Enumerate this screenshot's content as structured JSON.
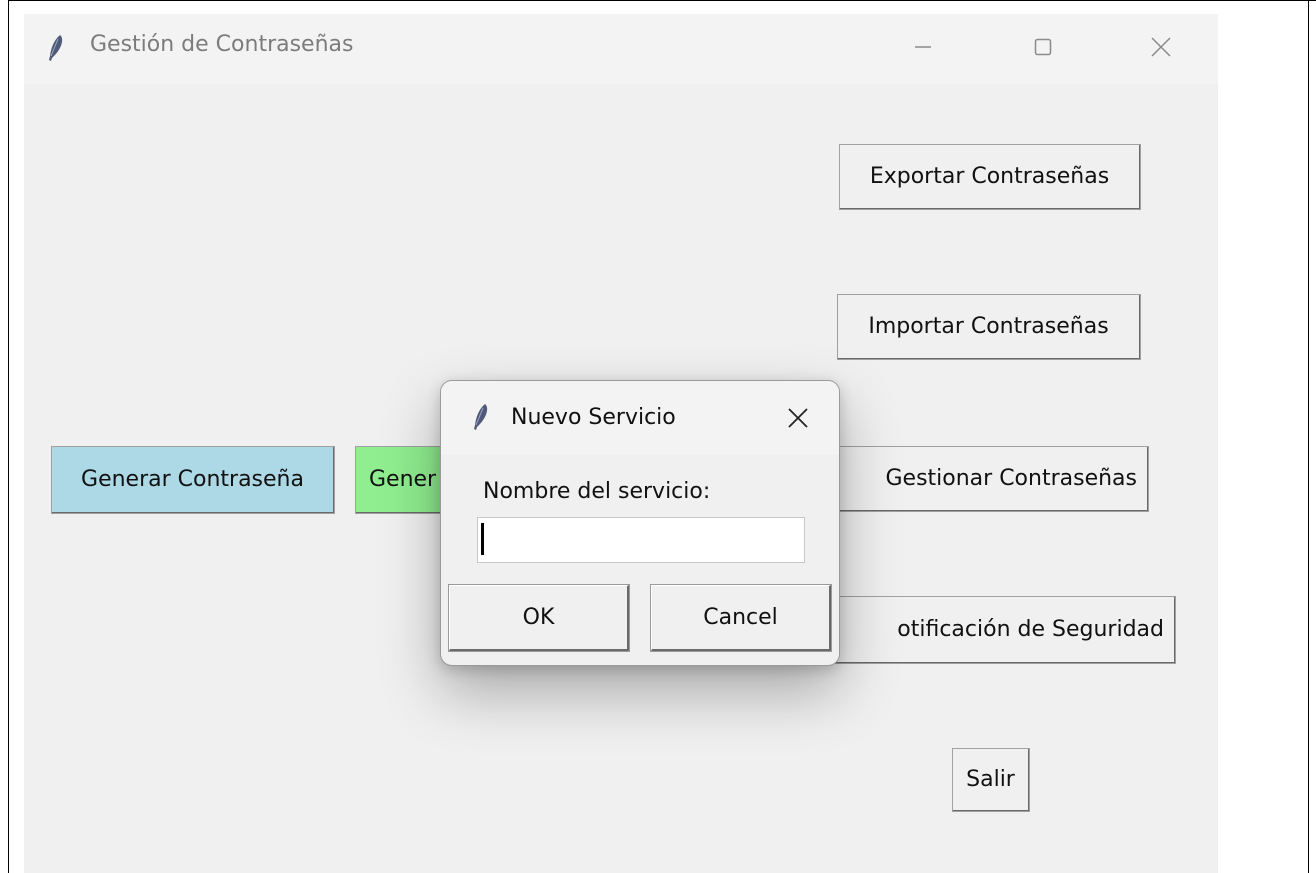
{
  "window": {
    "title": "Gestión de Contraseñas",
    "icon": "feather-icon"
  },
  "main": {
    "buttons": {
      "export": "Exportar Contraseñas",
      "import": "Importar Contraseñas",
      "manage": "Gestionar Contraseñas",
      "notify": "otificación de Seguridad",
      "exit": "Salir",
      "generate": "Generar Contraseña",
      "generate2_partial": "Gener"
    },
    "colors": {
      "generate_bg": "#add8e6",
      "generate2_bg": "#90ee90"
    }
  },
  "dialog": {
    "title": "Nuevo Servicio",
    "icon": "feather-icon",
    "label": "Nombre del servicio:",
    "input_value": "",
    "ok_label": "OK",
    "cancel_label": "Cancel"
  }
}
